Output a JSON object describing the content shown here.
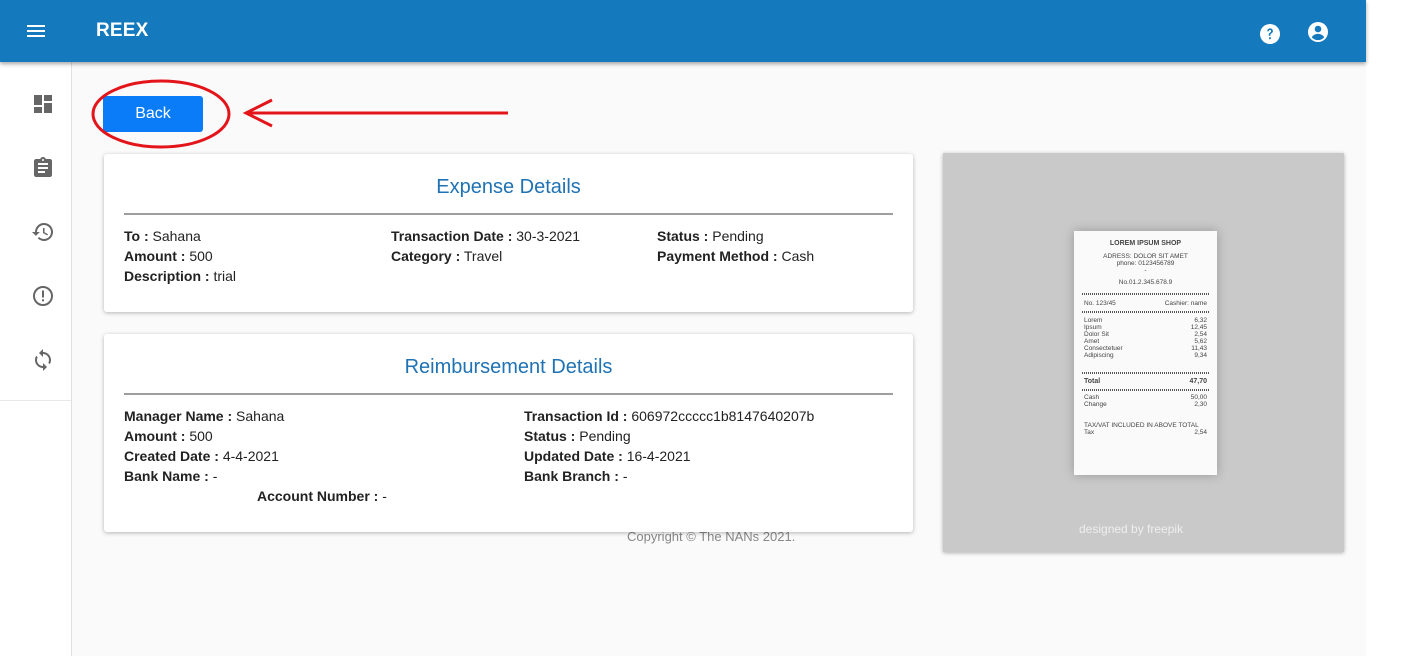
{
  "app": {
    "brand": "REEX"
  },
  "nav": {
    "back_label": "Back"
  },
  "expense": {
    "title": "Expense Details",
    "to_label": "To :",
    "to": "Sahana",
    "amount_label": "Amount :",
    "amount": "500",
    "description_label": "Description :",
    "description": "trial",
    "transaction_date_label": "Transaction Date :",
    "transaction_date": "30-3-2021",
    "category_label": "Category :",
    "category": "Travel",
    "status_label": "Status :",
    "status": "Pending",
    "payment_method_label": "Payment Method :",
    "payment_method": "Cash"
  },
  "reimbursement": {
    "title": "Reimbursement Details",
    "manager_name_label": "Manager Name :",
    "manager_name": "Sahana",
    "amount_label": "Amount :",
    "amount": "500",
    "created_date_label": "Created Date :",
    "created_date": "4-4-2021",
    "bank_name_label": "Bank Name :",
    "bank_name": "-",
    "account_number_label": "Account Number :",
    "account_number": "-",
    "transaction_id_label": "Transaction Id :",
    "transaction_id": "606972ccccc1b8147640207b",
    "status_label": "Status :",
    "status": "Pending",
    "updated_date_label": "Updated Date :",
    "updated_date": "16-4-2021",
    "bank_branch_label": "Bank Branch :",
    "bank_branch": "-"
  },
  "footer": {
    "copyright": "Copyright © The NANs 2021."
  },
  "receipt": {
    "shop": "LOREM IPSUM SHOP",
    "address": "ADRESS: DOLOR SIT AMET",
    "phone": "phone: 0123456789",
    "dash": "-",
    "number": "No.01.2.345.678.9",
    "no": "No. 123/45",
    "cashier": "Cashier: name",
    "items": [
      {
        "name": "Lorem",
        "price": "6,32"
      },
      {
        "name": "Ipsum",
        "price": "12,45"
      },
      {
        "name": "Dolor Sit",
        "price": "2,54"
      },
      {
        "name": "Amet",
        "price": "5,62"
      },
      {
        "name": "Consectetuer",
        "price": "11,43"
      },
      {
        "name": "Adipiscing",
        "price": "9,34"
      }
    ],
    "total_label": "Total",
    "total": "47,70",
    "cash_label": "Cash",
    "cash": "50,00",
    "change_label": "Change",
    "change": "2,30",
    "tax_note": "TAX/VAT INCLUDED IN ABOVE TOTAL",
    "tax_label": "Tax",
    "tax": "2,54",
    "credit": "designed by  freepik"
  },
  "colors": {
    "topbar": "#1479bd",
    "button": "#0a7cf8",
    "title": "#1f72b3",
    "annotation": "#e3151a"
  },
  "icons": {
    "menu": "menu-icon",
    "help": "help-icon",
    "account": "account-circle-icon",
    "dashboard": "dashboard-icon",
    "clipboard": "clipboard-icon",
    "history": "history-icon",
    "alert": "alert-circle-icon",
    "sync": "sync-icon"
  }
}
